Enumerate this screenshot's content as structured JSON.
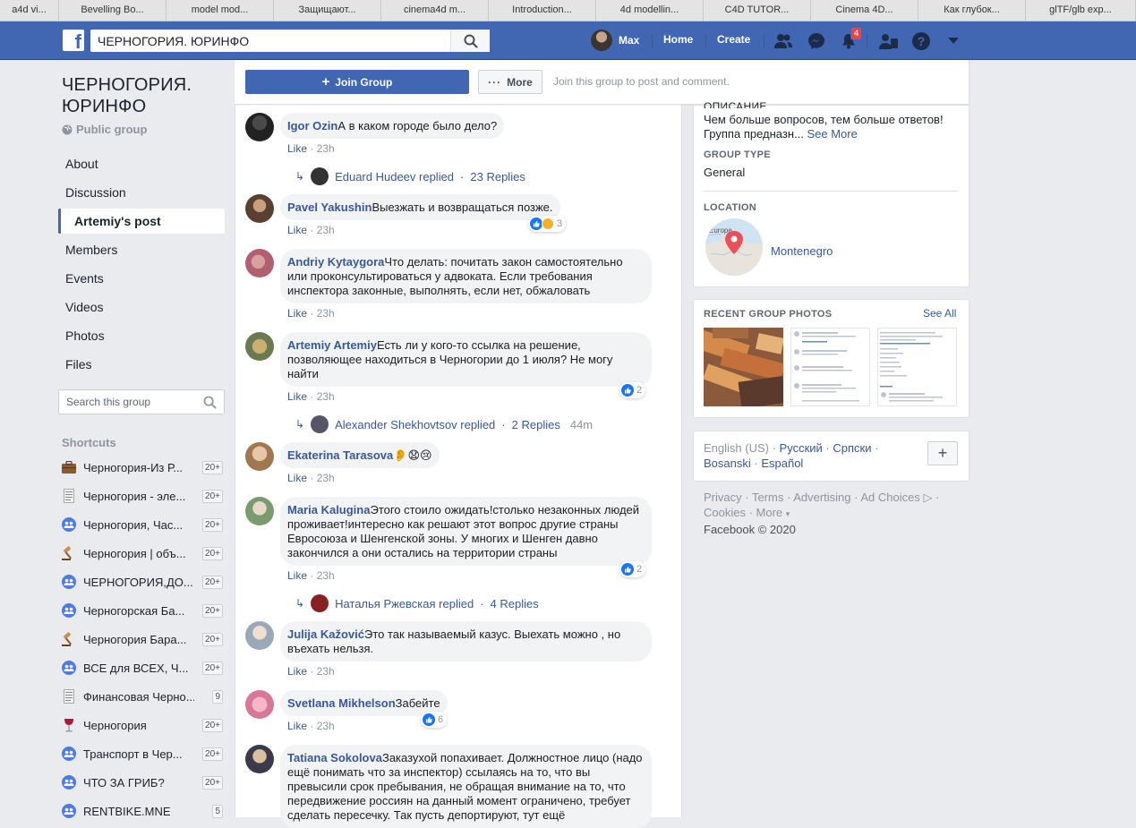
{
  "bookmarks": [
    "a4d vi...",
    "Bevelling Bo...",
    "model mod...",
    "Защищают...",
    "cinema4d m...",
    "Introduction...",
    "4d modellin...",
    "C4D TUTOR...",
    "Cinema 4D...",
    "Как глубок...",
    "glTF/glb exp..."
  ],
  "topbar": {
    "search_value": "ЧЕРНОГОРИЯ. ЮРИНФО",
    "user_name": "Max",
    "home": "Home",
    "create": "Create",
    "notification_count": "4",
    "brand_color": "#4267b2"
  },
  "group": {
    "title_line1": "ЧЕРНОГОРИЯ.",
    "title_line2": "ЮРИНФО",
    "privacy": "Public group",
    "nav": [
      "About",
      "Discussion",
      "Artemiy's post",
      "Members",
      "Events",
      "Videos",
      "Photos",
      "Files"
    ],
    "search_placeholder": "Search this group"
  },
  "shortcuts": {
    "title": "Shortcuts",
    "items": [
      {
        "name": "Черногория-Из Р...",
        "count": "20+",
        "icon": "briefcase-icon"
      },
      {
        "name": "Черногория - эле...",
        "count": "20+",
        "icon": "document-icon"
      },
      {
        "name": "Черногория, Час...",
        "count": "20+",
        "icon": "group-icon"
      },
      {
        "name": "Черногория | объ...",
        "count": "20+",
        "icon": "gavel-icon"
      },
      {
        "name": "ЧЕРНОГОРИЯ,ДО...",
        "count": "20+",
        "icon": "group-icon"
      },
      {
        "name": "Черногорская Ба...",
        "count": "20+",
        "icon": "group-icon"
      },
      {
        "name": "Черногория Бара...",
        "count": "20+",
        "icon": "gavel-icon"
      },
      {
        "name": "ВСЕ для ВСЕХ, Ч...",
        "count": "20+",
        "icon": "group-icon"
      },
      {
        "name": "Финансовая Черно...",
        "count": "9",
        "icon": "document-icon"
      },
      {
        "name": "Черногория",
        "count": "20+",
        "icon": "wine-icon"
      },
      {
        "name": "Транспорт в Чер...",
        "count": "20+",
        "icon": "group-icon"
      },
      {
        "name": "ЧТО ЗА ГРИБ?",
        "count": "20+",
        "icon": "group-icon"
      },
      {
        "name": "RENTBIKE.MNE",
        "count": "5",
        "icon": "group-icon"
      }
    ]
  },
  "actions": {
    "join": "Join Group",
    "more": "More",
    "hint": "Join this group to post and comment."
  },
  "comments": [
    {
      "author": "Igor Ozin",
      "text": "А в каком городе было дело?",
      "like": "Like",
      "time": "23h",
      "reply": {
        "who": "Eduard Hudeev replied",
        "count": "23 Replies",
        "time": ""
      }
    },
    {
      "author": "Pavel Yakushin",
      "text": "Выезжать и возвращаться позже.",
      "like": "Like",
      "time": "23h",
      "reactions": "3"
    },
    {
      "author": "Andriy Kytaygora",
      "text": "Что делать: почитать закон самостоятельно или проконсультироваться у адвоката. Если требования инспектора законные, выполнять, если нет, обжаловать",
      "like": "Like",
      "time": "23h"
    },
    {
      "author": "Artemiy Artemiy",
      "text": "Есть ли у кого-то ссылка на решение, позволяющее находиться в Черногории до 1 июля? Не могу найти",
      "like": "Like",
      "time": "23h",
      "reactions": "2",
      "reply": {
        "who": "Alexander Shekhovtsov replied",
        "count": "2 Replies",
        "time": "44m"
      }
    },
    {
      "author": "Ekaterina Tarasova",
      "text": "👂😧😢",
      "like": "Like",
      "time": "23h"
    },
    {
      "author": "Maria Kalugina",
      "text": "Этого стоило ожидать!столько незаконных людей проживает!интересно как решают этот вопрос другие страны Евросоюза и Шенгенской зоны. У многих и Шенген давно закончился а они остались на территории страны",
      "like": "Like",
      "time": "23h",
      "reactions": "2",
      "reply": {
        "who": "Наталья Ржевская replied",
        "count": "4 Replies",
        "time": ""
      }
    },
    {
      "author": "Julija Kažović",
      "text": "Это так называемый казус. Выехать можно , но въехать нельзя.",
      "like": "Like",
      "time": "23h"
    },
    {
      "author": "Svetlana Mikhelson",
      "text": "Забейте",
      "like": "Like",
      "time": "23h",
      "reactions": "6"
    },
    {
      "author": "Tatiana Sokolova",
      "text": "Заказухой попахивает. Должностное лицо (надо ещё понимать что за инспектор) ссылаясь на то, что вы превысили срок пребывания, не обращая внимание на то, что передвижение россиян на данный момент ограничено, требует сделать пересечку. Так пусть депортируют, тут ещё",
      "like": "",
      "time": ""
    }
  ],
  "about": {
    "description_label": "ОПИСАНИЕ",
    "description": "Чем больше вопросов, тем больше ответов! Группа предназн...",
    "see_more": "See More",
    "type_label": "GROUP TYPE",
    "type_value": "General",
    "location_label": "LOCATION",
    "location_value": "Montenegro",
    "map_word": "Europe"
  },
  "photos": {
    "label": "RECENT GROUP PHOTOS",
    "see_all": "See All"
  },
  "languages": {
    "current": "English (US)",
    "others": [
      "Русский",
      "Српски",
      "Bosanski",
      "Español"
    ]
  },
  "footer": {
    "links": [
      "Privacy",
      "Terms",
      "Advertising",
      "Ad Choices",
      "Cookies",
      "More"
    ],
    "copyright": "Facebook © 2020"
  }
}
